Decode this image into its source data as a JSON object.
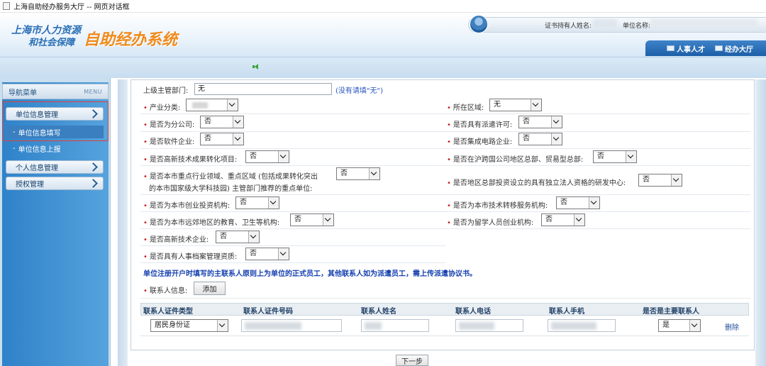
{
  "window": {
    "title": "上海自助经办服务大厅 -- 网页对话框"
  },
  "header": {
    "logo_line1": "上海市人力资源",
    "logo_line2": "和社会保障",
    "system_name": "自助经办系统",
    "cert_holder_label": "证书持有人姓名:",
    "unit_name_label": "单位名称:",
    "tabs": [
      {
        "label": "人事人才",
        "icon": "person-card-icon"
      },
      {
        "label": "经办大厅",
        "icon": "building-icon"
      }
    ]
  },
  "sidebar": {
    "header_label": "导航菜单",
    "header_menu": "MENU",
    "groups": [
      {
        "label": "单位信息管理",
        "items": [
          "单位信息填写",
          "单位信息上报"
        ]
      },
      {
        "label": "个人信息管理"
      },
      {
        "label": "授权管理"
      }
    ]
  },
  "form": {
    "supervisor": {
      "label": "上级主管部门:",
      "value": "无",
      "hint": "(没有请填\"无\")"
    },
    "fields": {
      "industry": {
        "label": "产业分类:"
      },
      "region": {
        "label": "所在区域:",
        "value": "无"
      },
      "branch": {
        "label": "是否为分公司:",
        "value": "否"
      },
      "dispatch_license": {
        "label": "是否具有派遣许可:",
        "value": "否"
      },
      "software": {
        "label": "是否软件企业:",
        "value": "否"
      },
      "ic": {
        "label": "是否集成电路企业:",
        "value": "否"
      },
      "hightech_transfer": {
        "label": "是否高新技术成果转化项目:",
        "value": "否"
      },
      "hq": {
        "label": "是否在沪跨国公司地区总部、贸易型总部:",
        "value": "否"
      },
      "key_unit_line1": {
        "label": "是否本市重点行业领域、重点区域 (包括成果转化突出"
      },
      "key_unit_line2": {
        "label": "的本市国家级大学科技园) 主管部门推荐的重点单位:",
        "value": "否"
      },
      "rd_center": {
        "label": "是否地区总部投资设立的具有独立法人资格的研发中心:",
        "value": "否"
      },
      "venture": {
        "label": "是否为本市创业投资机构:",
        "value": "否"
      },
      "tech_transfer": {
        "label": "是否为本市技术转移服务机构:",
        "value": "否"
      },
      "suburb": {
        "label": "是否为本市远郊地区的教育、卫生等机构:",
        "value": "否"
      },
      "returnee": {
        "label": "是否为留学人员创业机构:",
        "value": "否"
      },
      "hightech": {
        "label": "是否高新技术企业:",
        "value": "否"
      },
      "archive": {
        "label": "是否具有人事档案管理资质:",
        "value": "否"
      }
    },
    "notice": "单位注册开户时填写的主联系人原则上为单位的正式员工，其他联系人如为派遣员工，需上传派遣协议书。",
    "contact": {
      "label": "联系人信息:",
      "add_button": "添加"
    },
    "table": {
      "headers": [
        "联系人证件类型",
        "联系人证件号码",
        "联系人姓名",
        "联系人电话",
        "联系人手机",
        "是否是主要联系人"
      ],
      "row": {
        "id_type": "居民身份证",
        "is_primary": "是",
        "delete": "删除"
      }
    },
    "next_button": "下一步"
  }
}
